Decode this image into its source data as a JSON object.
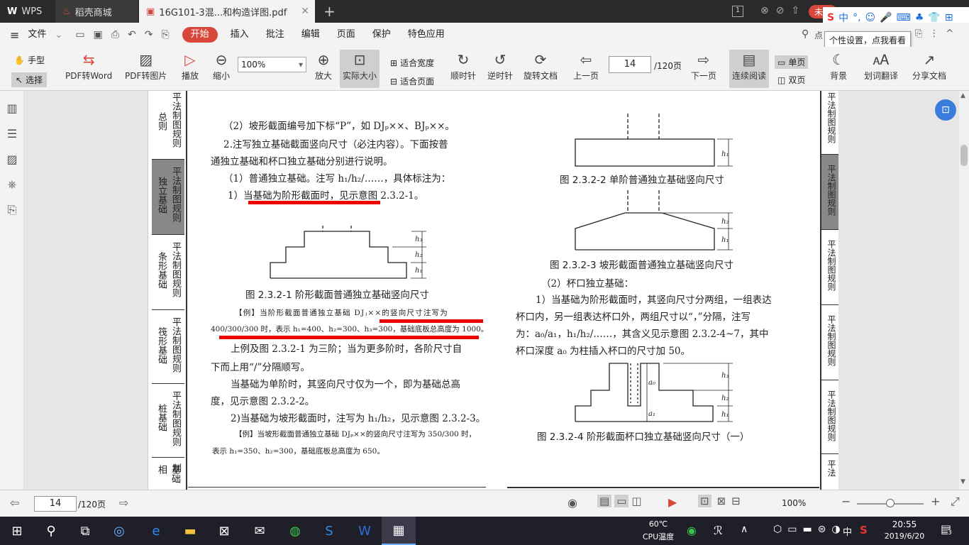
{
  "tabs": [
    {
      "label": "WPS"
    },
    {
      "label": "稻壳商城"
    },
    {
      "label": "16G101-3混...和构造详图.pdf"
    }
  ],
  "window": {
    "badge": "1",
    "user_label": "未登"
  },
  "menu": {
    "file": "文件",
    "items": [
      "开始",
      "插入",
      "批注",
      "编辑",
      "页面",
      "保护",
      "特色应用"
    ],
    "search_char": "点"
  },
  "tooltip": "个性设置，点我看看",
  "toolbar": {
    "hand": "手型",
    "select": "选择",
    "pdf2word": "PDF转Word",
    "pdf2img": "PDF转图片",
    "play": "播放",
    "zoomout": "缩小",
    "zoom": "100%",
    "zoomin": "放大",
    "actual": "实际大小",
    "fitwidth": "适合宽度",
    "fitpage": "适合页面",
    "cw": "顺时针",
    "ccw": "逆时针",
    "rotate": "旋转文档",
    "prev": "上一页",
    "page": "14",
    "total": "/120页",
    "next": "下一页",
    "continuous": "连续阅读",
    "single": "单页",
    "double": "双页",
    "bg": "背景",
    "translate": "划词翻译",
    "share": "分享文档"
  },
  "sidetabs_left": [
    "平法制图规则",
    "总则",
    "平法制图规则",
    "独立基础",
    "平法制图规则",
    "条形基础",
    "平法制图规则",
    "筏形基础",
    "平法制图规则",
    "桩基础",
    "平法制",
    "基础相"
  ],
  "sidetabs_right": [
    "平法制图规则",
    "平法制图规则",
    "平法制图规则",
    "平法制图规则",
    "平法制图规则",
    "平法"
  ],
  "left_col": {
    "l1": "（2）坡形截面编号加下标“P”，如 DJₚ××、BJₚ××。",
    "l2": "2.注写独立基础截面竖向尺寸（必注内容）。下面按普",
    "l3": "通独立基础和杯口独立基础分别进行说明。",
    "l4": "（1）普通独立基础。注写 h₁/h₂/……，具体标注为：",
    "l5": "1）当基础为阶形截面时，见示意图 2.3.2-1。",
    "cap1": "图 2.3.2-1  阶形截面普通独立基础竖向尺寸",
    "ex1a": "【例】当阶形截面普通独立基础 DJⱼ××的竖向尺寸注写为",
    "ex1b": "400/300/300 时，表示 h₁=400、h₂=300、h₃=300，基础底板总高度为 1000。",
    "l6": "上例及图 2.3.2-1 为三阶；当为更多阶时，各阶尺寸自",
    "l7": "下而上用“/”分隔顺写。",
    "l8": "当基础为单阶时，其竖向尺寸仅为一个，即为基础总高",
    "l9": "度，见示意图 2.3.2-2。",
    "l10": "2)当基础为坡形截面时，注写为 h₁/h₂，见示意图 2.3.2-3。",
    "ex2a": "【例】当坡形截面普通独立基础 DJₚ××的竖向尺寸注写为 350/300 时，",
    "ex2b": "表示 h₁=350、h₂=300，基础底板总高度为 650。"
  },
  "right_col": {
    "cap2": "图 2.3.2-2  单阶普通独立基础竖向尺寸",
    "cap3": "图 2.3.2-3  坡形截面普通独立基础竖向尺寸",
    "r1": "（2）杯口独立基础：",
    "r2": "1）当基础为阶形截面时，其竖向尺寸分两组，一组表达",
    "r3": "杯口内，另一组表达杯口外，两组尺寸以“，”分隔，注写",
    "r4": "为：a₀/a₁，h₁/h₂/……，其含义见示意图 2.3.2-4~7，其中",
    "r5": "杯口深度 a₀ 为柱插入杯口的尺寸加 50。",
    "cap4": "图 2.3.2-4  阶形截面杯口独立基础竖向尺寸（一）"
  },
  "status": {
    "page": "14",
    "total": "/120页",
    "zoom": "100%"
  },
  "taskbar": {
    "temp": "60℃",
    "cpu": "CPU温度",
    "lang": "中",
    "time": "20:55",
    "date": "2019/6/20",
    "notif": "3"
  }
}
